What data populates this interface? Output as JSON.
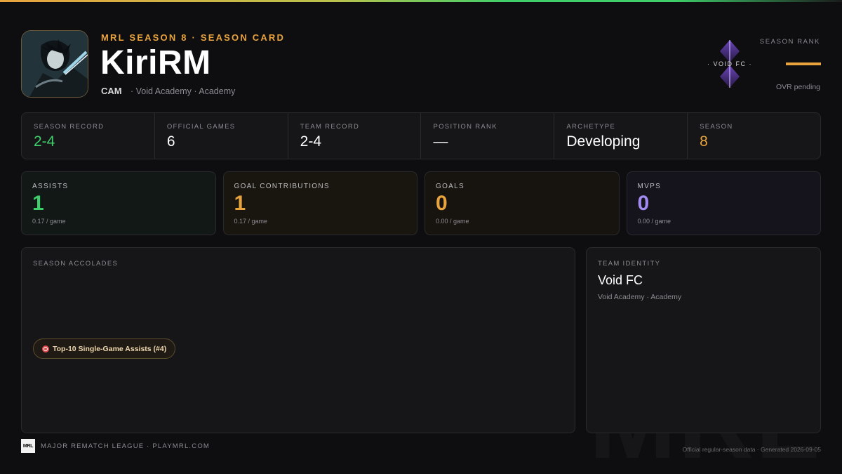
{
  "header": {
    "eyebrow": "MRL SEASON 8 · SEASON CARD",
    "player_name": "KiriRM",
    "position": "CAM",
    "team_line": "· Void Academy · Academy"
  },
  "crest": {
    "label": "· VOID FC ·"
  },
  "rank": {
    "label": "SEASON RANK",
    "ovr_text": "OVR pending",
    "accent": "#e8a33d"
  },
  "stats": [
    {
      "label": "SEASON RECORD",
      "value": "2-4"
    },
    {
      "label": "OFFICIAL GAMES",
      "value": "6"
    },
    {
      "label": "TEAM RECORD",
      "value": "2-4"
    },
    {
      "label": "POSITION RANK",
      "value": "—"
    },
    {
      "label": "ARCHETYPE",
      "value": "Developing"
    },
    {
      "label": "SEASON",
      "value": "8"
    }
  ],
  "cards": [
    {
      "label": "ASSISTS",
      "value": "1",
      "sub": "0.17 / game",
      "color": "#3ecf6a"
    },
    {
      "label": "GOAL CONTRIBUTIONS",
      "value": "1",
      "sub": "0.17 / game",
      "color": "#e8a33d"
    },
    {
      "label": "GOALS",
      "value": "0",
      "sub": "0.00 / game",
      "color": "#e8a33d"
    },
    {
      "label": "MVPS",
      "value": "0",
      "sub": "0.00 / game",
      "color": "#a28bf0"
    }
  ],
  "accolades": {
    "label": "SEASON ACCOLADES",
    "items": [
      {
        "icon": "target-icon",
        "text": "Top-10 Single-Game Assists (#4)"
      }
    ]
  },
  "identity": {
    "label": "TEAM IDENTITY",
    "team_name": "Void FC",
    "sub": "Void Academy · Academy"
  },
  "footer": {
    "logo_text": "MRL",
    "left": "MAJOR REMATCH LEAGUE · PLAYMRL.COM",
    "right": "Official regular-season data · Generated 2026-09-05",
    "watermark": "MRL"
  }
}
